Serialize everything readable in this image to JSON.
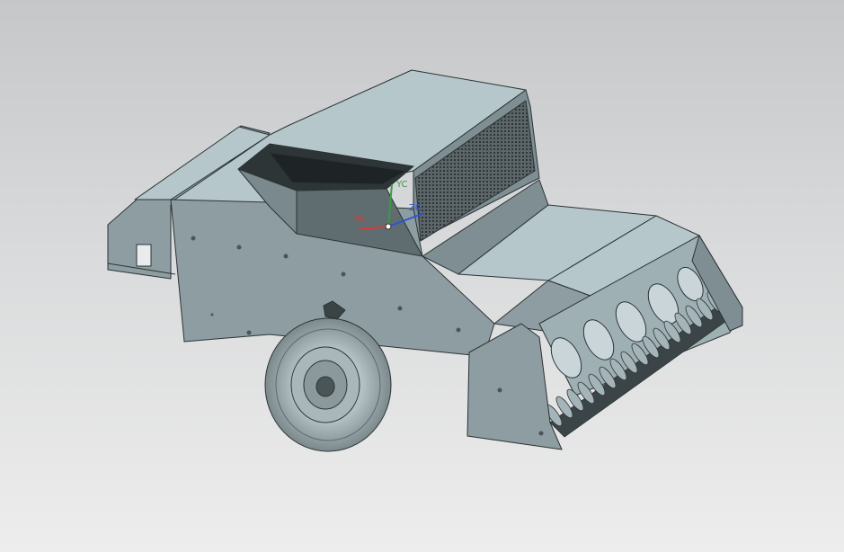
{
  "viewport": {
    "background_top": "#c6c7c9",
    "background_bottom": "#ededed"
  },
  "model": {
    "body_color": "#8e9da1",
    "top_color": "#b6c7cb",
    "edge_color": "#2b3335",
    "parts": [
      "chassis",
      "bale-chamber",
      "hopper",
      "mesh-screen",
      "feed-auger",
      "pickup-reel",
      "wheel"
    ]
  },
  "triad": {
    "x_label": "XC",
    "y_label": "YC",
    "z_label": "ZC",
    "x_color": "#d43a3a",
    "y_color": "#3a9a4a",
    "z_color": "#2a55d6"
  }
}
